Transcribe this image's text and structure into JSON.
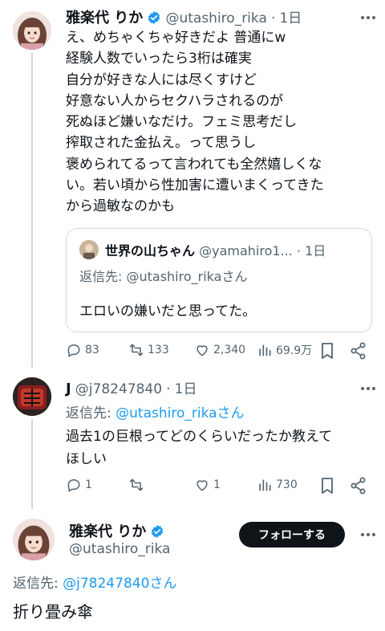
{
  "tweet1": {
    "display_name": "雅楽代 りか",
    "handle": "@utashiro_rika",
    "dot": "·",
    "time": "1日",
    "text": "え、めちゃくちゃ好きだよ 普通にw\n経験人数でいったら3桁は確実\n自分が好きな人には尽くすけど\n好意ない人からセクハラされるのが\n死ぬほど嫌いなだけ。フェミ思考だし\n搾取された金払え。って思うし\n褒められてるって言われても全然嬉しくな\nい。若い頃から性加害に遭いまくってきた\nから過敏なのかも",
    "quote": {
      "display_name": "世界の山ちゃん",
      "handle": "@yamahiro1...",
      "dot": "·",
      "time": "1日",
      "reply_prefix": "返信先: ",
      "reply_to": "@utashiro_rikaさん",
      "text": "エロいの嫌いだと思ってた。"
    },
    "stats": {
      "replies": "83",
      "reposts": "133",
      "likes": "2,340",
      "views": "69.9万"
    }
  },
  "tweet2": {
    "display_name": "J",
    "handle": "@j78247840",
    "dot": "·",
    "time": "1日",
    "reply_prefix": "返信先: ",
    "reply_to": "@utashiro_rikaさん",
    "text": "過去1の巨根ってどのくらいだったか教えて\nほしい",
    "stats": {
      "replies": "1",
      "reposts": "",
      "likes": "1",
      "views": "730"
    }
  },
  "tweet3": {
    "display_name": "雅楽代 りか",
    "handle": "@utashiro_rika",
    "follow_label": "フォローする",
    "reply_prefix": "返信先: ",
    "reply_to": "@j78247840さん",
    "text": "折り畳み傘"
  },
  "colors": {
    "text": "#0f1419",
    "muted": "#536471",
    "link": "#1d9bf0",
    "verified": "#1d9bf0"
  },
  "icons": [
    "verified-badge-icon",
    "more-icon",
    "reply-icon",
    "repost-icon",
    "like-icon",
    "views-icon",
    "bookmark-icon",
    "share-icon"
  ]
}
